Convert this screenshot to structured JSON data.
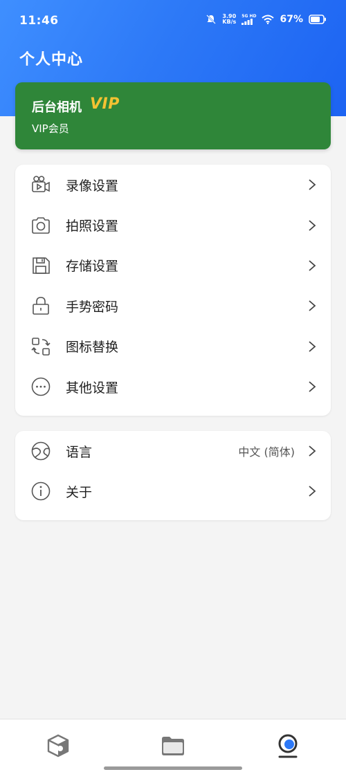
{
  "status_bar": {
    "time": "11:46",
    "net_speed_value": "3.90",
    "net_speed_unit": "KB/s",
    "signal_label": "5G HD",
    "battery": "67%"
  },
  "header": {
    "title": "个人中心"
  },
  "vip": {
    "app_name": "后台相机",
    "badge": "VIP",
    "membership": "VIP会员"
  },
  "settings": {
    "items": [
      {
        "label": "录像设置",
        "icon": "video-camera-icon"
      },
      {
        "label": "拍照设置",
        "icon": "camera-icon"
      },
      {
        "label": "存储设置",
        "icon": "save-disk-icon"
      },
      {
        "label": "手势密码",
        "icon": "lock-icon"
      },
      {
        "label": "图标替换",
        "icon": "icon-replace-icon"
      },
      {
        "label": "其他设置",
        "icon": "more-dots-icon"
      }
    ]
  },
  "about_section": {
    "language": {
      "label": "语言",
      "value": "中文 (简体)",
      "icon": "globe-icon"
    },
    "about": {
      "label": "关于",
      "icon": "info-icon"
    }
  },
  "colors": {
    "header_blue": "#2d79f7",
    "vip_green": "#2f8639",
    "vip_gold": "#f3c232",
    "nav_active": "#2d79f7"
  },
  "bottom_nav": {
    "items": [
      {
        "icon": "cube-camera-icon",
        "active": false
      },
      {
        "icon": "folder-icon",
        "active": false
      },
      {
        "icon": "profile-webcam-icon",
        "active": true
      }
    ]
  }
}
